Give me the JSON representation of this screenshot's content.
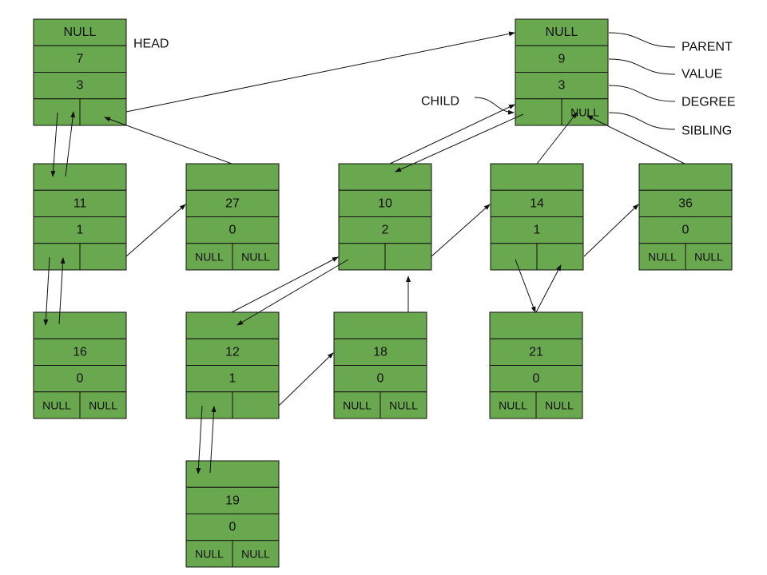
{
  "colors": {
    "node_fill": "#6aa84f",
    "stroke": "#111111"
  },
  "labels": {
    "head": "HEAD",
    "child": "CHILD",
    "parent": "PARENT",
    "value": "VALUE",
    "degree": "DEGREE",
    "sibling": "SIBLING"
  },
  "nodes": [
    {
      "id": "n7",
      "parent": "NULL",
      "value": "7",
      "degree": "3",
      "child": "",
      "sibling": ""
    },
    {
      "id": "n9",
      "parent": "NULL",
      "value": "9",
      "degree": "3",
      "child": "",
      "sibling": "NULL"
    },
    {
      "id": "n11",
      "parent": "",
      "value": "11",
      "degree": "1",
      "child": "",
      "sibling": ""
    },
    {
      "id": "n27",
      "parent": "",
      "value": "27",
      "degree": "0",
      "child": "NULL",
      "sibling": "NULL"
    },
    {
      "id": "n10",
      "parent": "",
      "value": "10",
      "degree": "2",
      "child": "",
      "sibling": ""
    },
    {
      "id": "n14",
      "parent": "",
      "value": "14",
      "degree": "1",
      "child": "",
      "sibling": ""
    },
    {
      "id": "n36",
      "parent": "",
      "value": "36",
      "degree": "0",
      "child": "NULL",
      "sibling": "NULL"
    },
    {
      "id": "n16",
      "parent": "",
      "value": "16",
      "degree": "0",
      "child": "NULL",
      "sibling": "NULL"
    },
    {
      "id": "n12",
      "parent": "",
      "value": "12",
      "degree": "1",
      "child": "",
      "sibling": ""
    },
    {
      "id": "n18",
      "parent": "",
      "value": "18",
      "degree": "0",
      "child": "NULL",
      "sibling": "NULL"
    },
    {
      "id": "n21",
      "parent": "",
      "value": "21",
      "degree": "0",
      "child": "NULL",
      "sibling": "NULL"
    },
    {
      "id": "n19",
      "parent": "",
      "value": "19",
      "degree": "0",
      "child": "NULL",
      "sibling": "NULL"
    }
  ]
}
